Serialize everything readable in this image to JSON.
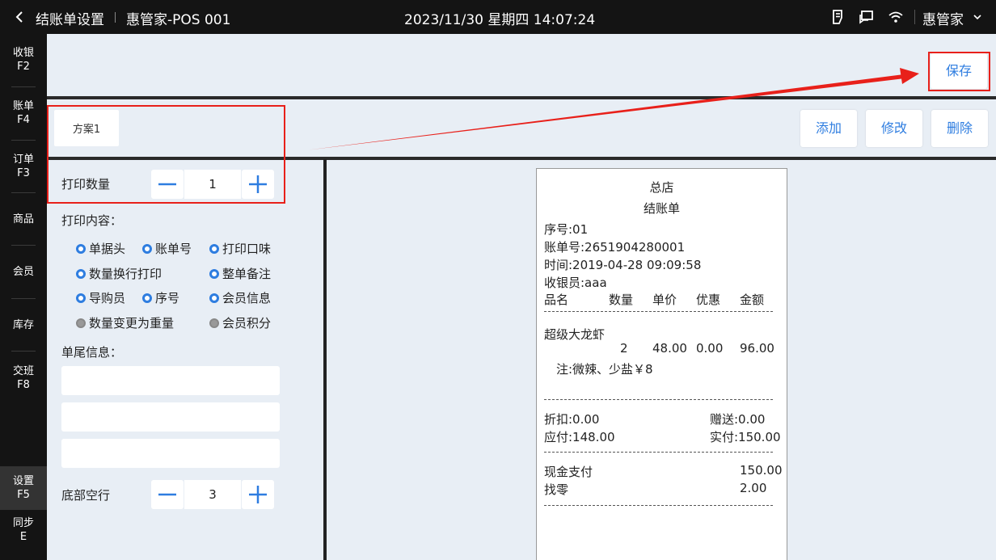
{
  "topbar": {
    "title": "结账单设置",
    "store": "惠管家-POS 001",
    "datetime": "2023/11/30 星期四 14:07:24",
    "user": "惠管家"
  },
  "sidebar": {
    "items": [
      {
        "label": "收银",
        "key": "F2"
      },
      {
        "label": "账单",
        "key": "F4"
      },
      {
        "label": "订单",
        "key": "F3"
      },
      {
        "label": "商品",
        "key": ""
      },
      {
        "label": "会员",
        "key": ""
      },
      {
        "label": "库存",
        "key": ""
      },
      {
        "label": "交班",
        "key": "F8"
      },
      {
        "label": "设置",
        "key": "F5"
      },
      {
        "label": "同步",
        "key": "E"
      }
    ]
  },
  "actions": {
    "save": "保存",
    "add": "添加",
    "edit": "修改",
    "delete": "删除"
  },
  "plan_tab": "方案1",
  "settings": {
    "print_count_label": "打印数量",
    "print_count": "1",
    "print_content_label": "打印内容：",
    "options": {
      "header": "单据头",
      "bill_no": "账单号",
      "print_taste": "打印口味",
      "qty_wrap": "数量换行打印",
      "order_note": "整单备注",
      "guide": "导购员",
      "serial": "序号",
      "member_info": "会员信息",
      "qty_to_weight": "数量变更为重量",
      "member_points": "会员积分"
    },
    "footer_label": "单尾信息：",
    "blank_lines_label": "底部空行",
    "blank_lines": "3"
  },
  "receipt": {
    "store": "总店",
    "title": "结账单",
    "serial": "序号:01",
    "bill_no": "账单号:2651904280001",
    "time": "时间:2019-04-28 09:09:58",
    "cashier": "收银员:aaa",
    "headers": {
      "name": "品名",
      "qty": "数量",
      "price": "单价",
      "discount": "优惠",
      "amount": "金额"
    },
    "item": {
      "name": "超级大龙虾",
      "qty": "2",
      "price": "48.00",
      "discount": "0.00",
      "amount": "96.00",
      "note": "注:微辣、少盐￥8"
    },
    "discount": "折扣:0.00",
    "gift": "赠送:0.00",
    "payable": "应付:148.00",
    "paid": "实付:150.00",
    "pay_method": "现金支付",
    "pay_amount": "150.00",
    "change_label": "找零",
    "change": "2.00"
  }
}
